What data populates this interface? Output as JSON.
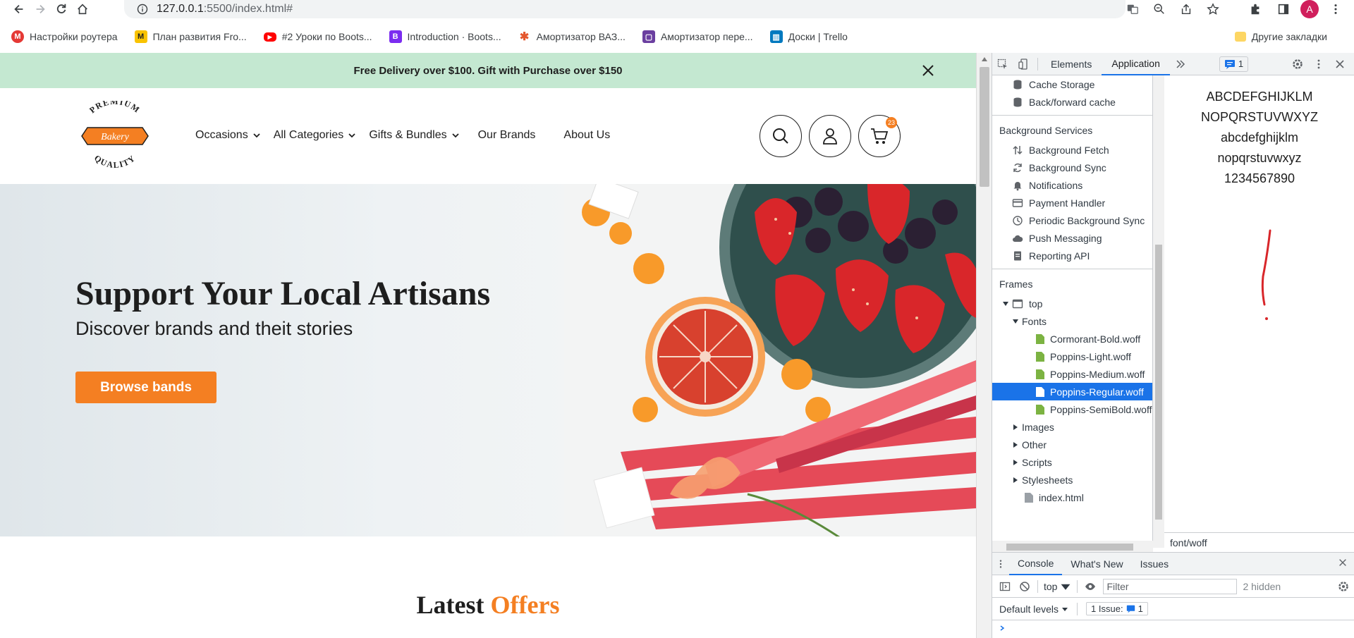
{
  "browser": {
    "url_host": "127.0.0.1",
    "url_path": ":5500/index.html#",
    "profile_initial": "A"
  },
  "bookmarks": [
    {
      "label": "Настройки роутера",
      "color": "#e53935",
      "glyph": "M"
    },
    {
      "label": "План развития Fro...",
      "color": "#f9c300",
      "glyph": "M"
    },
    {
      "label": "#2 Уроки по Boots...",
      "color": "#ff0000",
      "glyph": "▶"
    },
    {
      "label": "Introduction · Boots...",
      "color": "#7b2cf0",
      "glyph": "B"
    },
    {
      "label": "Амортизатор ВАЗ...",
      "color": "#e4572e",
      "glyph": "✱"
    },
    {
      "label": "Амортизатор пере...",
      "color": "#6b3fa0",
      "glyph": "▢"
    },
    {
      "label": "Доски | Trello",
      "color": "#0079bf",
      "glyph": "▥"
    }
  ],
  "bookmarks_other": "Другие закладки",
  "site": {
    "promo_text": "Free Delivery over $100. Gift with Purchase over $150",
    "logo": {
      "top": "PREMIUM",
      "middle": "Bakery",
      "bottom": "QUALITY"
    },
    "nav": [
      {
        "label": "Occasions",
        "dropdown": true
      },
      {
        "label": "All Categories",
        "dropdown": true
      },
      {
        "label": "Gifts & Bundles",
        "dropdown": true
      },
      {
        "label": "Our Brands",
        "dropdown": false
      },
      {
        "label": "About Us",
        "dropdown": false
      }
    ],
    "cart_count": "23",
    "hero": {
      "title": "Support Your Local Artisans",
      "subtitle": "Discover brands and theit stories",
      "button": "Browse bands"
    },
    "section_title_plain": "Latest",
    "section_title_accent": "Offers",
    "accent_color": "#f47f22"
  },
  "devtools": {
    "tabs": [
      "Elements",
      "Application"
    ],
    "active_tab": "Application",
    "issues_count": "1",
    "storage_items": [
      "Cache Storage",
      "Back/forward cache"
    ],
    "background_services_header": "Background Services",
    "background_services": [
      {
        "label": "Background Fetch",
        "icon": "arrows-updown-icon"
      },
      {
        "label": "Background Sync",
        "icon": "sync-icon"
      },
      {
        "label": "Notifications",
        "icon": "bell-icon"
      },
      {
        "label": "Payment Handler",
        "icon": "card-icon"
      },
      {
        "label": "Periodic Background Sync",
        "icon": "clock-icon"
      },
      {
        "label": "Push Messaging",
        "icon": "cloud-icon"
      },
      {
        "label": "Reporting API",
        "icon": "document-icon"
      }
    ],
    "frames_header": "Frames",
    "frame_top": "top",
    "fonts_folder": "Fonts",
    "fonts": [
      "Cormorant-Bold.woff",
      "Poppins-Light.woff",
      "Poppins-Medium.woff",
      "Poppins-Regular.woff",
      "Poppins-SemiBold.woff"
    ],
    "selected_font": "Poppins-Regular.woff",
    "folders": [
      "Images",
      "Other",
      "Scripts",
      "Stylesheets"
    ],
    "index_file": "index.html",
    "preview_lines": [
      "ABCDEFGHIJKLM",
      "NOPQRSTUVWXYZ",
      "abcdefghijklm",
      "nopqrstuvwxyz",
      "1234567890"
    ],
    "preview_mime": "font/woff",
    "console_tabs": [
      "Console",
      "What's New",
      "Issues"
    ],
    "context": "top",
    "filter_placeholder": "Filter",
    "hidden_count": "2 hidden",
    "levels": "Default levels",
    "issue_label": "1 Issue:",
    "issue_num": "1"
  }
}
